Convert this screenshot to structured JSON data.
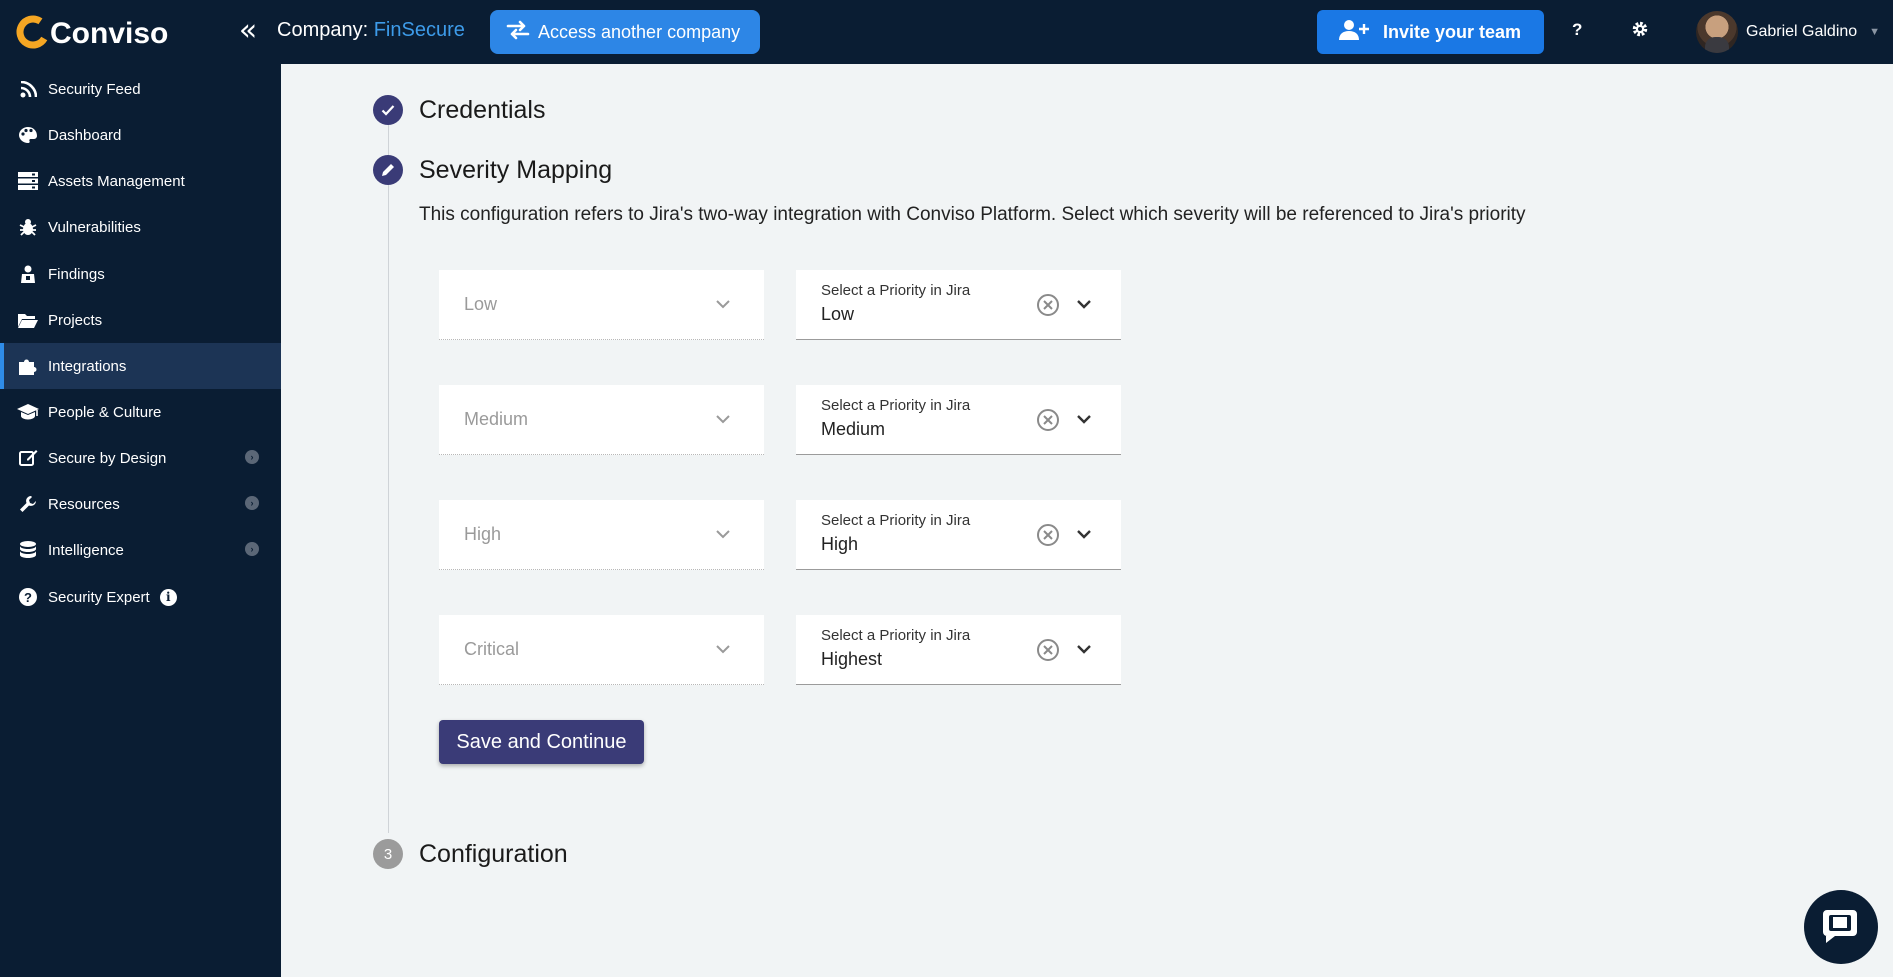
{
  "header": {
    "logo_text": "Conviso",
    "company_label": "Company:",
    "company_name": "FinSecure",
    "access_button": "Access another company",
    "invite_button": "Invite your team",
    "help_label": "?",
    "user_name": "Gabriel Galdino"
  },
  "sidebar": {
    "items": [
      {
        "label": "Security Feed",
        "icon": "rss-icon"
      },
      {
        "label": "Dashboard",
        "icon": "palette-icon"
      },
      {
        "label": "Assets Management",
        "icon": "server-icon"
      },
      {
        "label": "Vulnerabilities",
        "icon": "bug-icon"
      },
      {
        "label": "Findings",
        "icon": "findings-icon"
      },
      {
        "label": "Projects",
        "icon": "folder-icon"
      },
      {
        "label": "Integrations",
        "icon": "puzzle-icon",
        "active": true
      },
      {
        "label": "People & Culture",
        "icon": "graduation-cap-icon"
      },
      {
        "label": "Secure by Design",
        "icon": "edit-icon",
        "expandable": true
      },
      {
        "label": "Resources",
        "icon": "wrench-icon",
        "expandable": true
      },
      {
        "label": "Intelligence",
        "icon": "database-icon",
        "expandable": true
      },
      {
        "label": "Security Expert",
        "icon": "question-circle-icon",
        "info": "i"
      }
    ]
  },
  "steps": {
    "credentials": {
      "title": "Credentials",
      "state": "done"
    },
    "severity": {
      "title": "Severity Mapping",
      "state": "editing",
      "description": "This configuration refers to Jira's two-way integration with Conviso Platform. Select which severity will be referenced to Jira's priority",
      "rows": [
        {
          "severity": "Low",
          "priority_label": "Select a Priority in Jira",
          "priority": "Low"
        },
        {
          "severity": "Medium",
          "priority_label": "Select a Priority in Jira",
          "priority": "Medium"
        },
        {
          "severity": "High",
          "priority_label": "Select a Priority in Jira",
          "priority": "High"
        },
        {
          "severity": "Critical",
          "priority_label": "Select a Priority in Jira",
          "priority": "Highest"
        }
      ],
      "save_button": "Save and Continue"
    },
    "configuration": {
      "number": "3",
      "title": "Configuration",
      "state": "pending"
    }
  },
  "colors": {
    "nav_bg": "#0a1d33",
    "accent": "#3a3b77",
    "link": "#3d9be9",
    "primary_button": "#1a78e5"
  }
}
